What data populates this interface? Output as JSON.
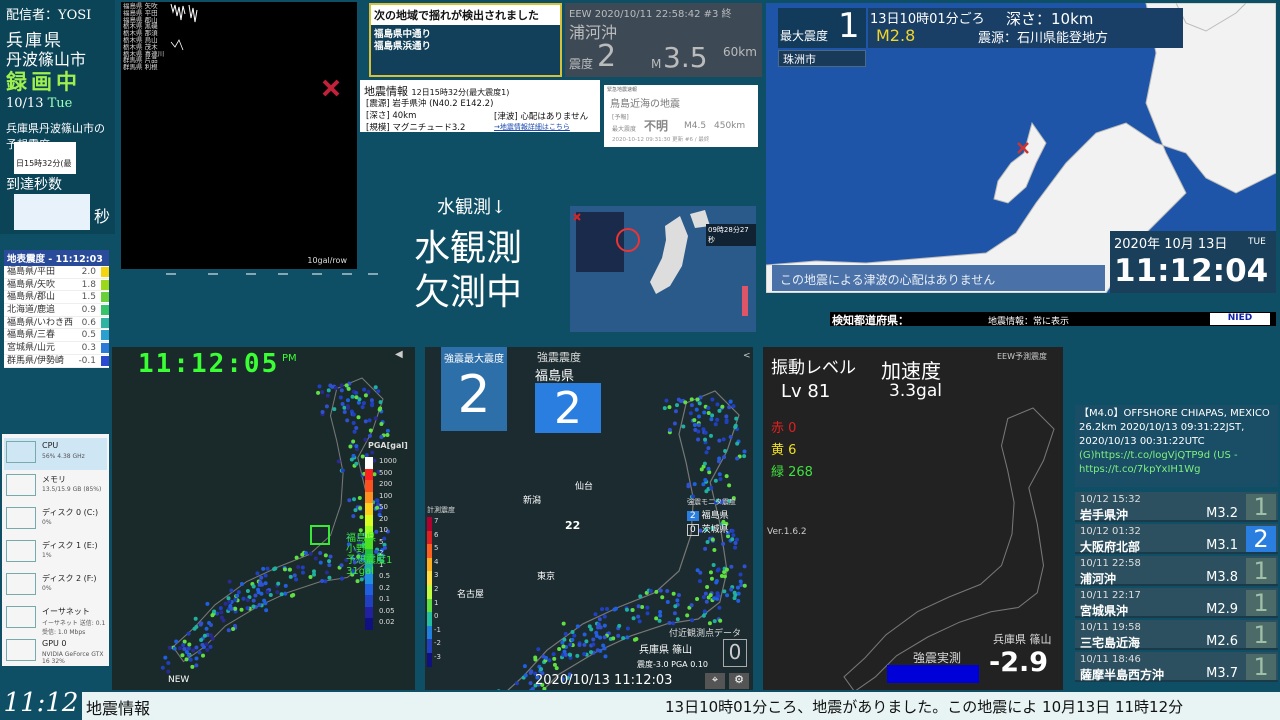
{
  "left": {
    "streamer": "配信者：YOSI",
    "prefecture": "兵庫県",
    "city": "丹波篠山市",
    "recording": "録画中",
    "date": "10/13",
    "weekday": "Tue",
    "forecast_label_1": "兵庫県丹波篠山市の",
    "forecast_label_2": "予想震度",
    "small_1": "日15時32分(最",
    "arrival_label": "到達秒数",
    "seconds_unit": "秒"
  },
  "waveform": {
    "stations": [
      "福島県 矢吹",
      "福島県 平田",
      "福島県 郡山",
      "栃木県 黒磯",
      "栃木県 那須",
      "栃木県 烏山",
      "栃木県 茂木",
      "栃木県 喜連川",
      "群馬県 片品",
      "群馬県 利根"
    ],
    "scale": "10gal/row"
  },
  "seismo_list": {
    "title": "地表震度 - 11:12:03",
    "rows": [
      {
        "name": "福島県/平田",
        "value": "2.0",
        "color": "#f4d40c"
      },
      {
        "name": "福島県/矢吹",
        "value": "1.8",
        "color": "#9bd81a"
      },
      {
        "name": "福島県/郡山",
        "value": "1.5",
        "color": "#6ad03a"
      },
      {
        "name": "北海道/鹿追",
        "value": "0.9",
        "color": "#36c36a"
      },
      {
        "name": "福島県/いわき西",
        "value": "0.6",
        "color": "#2eb4a0"
      },
      {
        "name": "福島県/三春",
        "value": "0.5",
        "color": "#2a9fd0"
      },
      {
        "name": "宮城県/山元",
        "value": "0.3",
        "color": "#2a7ad8"
      },
      {
        "name": "群馬県/伊勢崎",
        "value": "-0.1",
        "color": "#2a4ad0"
      }
    ]
  },
  "perf": [
    {
      "name": "CPU",
      "detail": "56% 4.38 GHz"
    },
    {
      "name": "メモリ",
      "detail": "13.5/15.9 GB (85%)"
    },
    {
      "name": "ディスク 0 (C:)",
      "detail": "0%"
    },
    {
      "name": "ディスク 1 (E:)",
      "detail": "1%"
    },
    {
      "name": "ディスク 2 (F:)",
      "detail": "0%"
    },
    {
      "name": "イーサネット",
      "detail": "イーサネット 送信: 0.1 受信: 1.0 Mbps"
    },
    {
      "name": "GPU 0",
      "detail": "NVIDIA GeForce GTX 16 32%"
    }
  ],
  "detect": {
    "header": "次の地域で揺れが検出されました",
    "areas": [
      "福島県中通り",
      "福島県浜通り"
    ]
  },
  "eew": {
    "meta": "EEW 2020/10/11 22:58:42 #3 終",
    "place": "浦河沖",
    "intensity_label": "震度",
    "intensity": "2",
    "mag_label": "M",
    "mag": "3.5",
    "depth": "60km"
  },
  "info12": {
    "title": "地震情報",
    "sub": "12日15時32分(最大震度1)",
    "epicenter_label": "[震源]",
    "epicenter": "岩手県沖",
    "coords": "(N40.2 E142.2)",
    "depth_label": "[深さ]",
    "depth": "40km",
    "tsunami_label": "[津波]",
    "tsunami": "心配はありません",
    "scale_label": "[規模]",
    "scale": "マグニチュード3.2",
    "link": "→地震情報詳細はこちら"
  },
  "forecast": {
    "head": "緊急地震速報",
    "place": "鳥島近海の地震",
    "tag": "[予報]",
    "max_label": "最大震度",
    "max": "不明",
    "mag": "M4.5",
    "depth": "450km",
    "time": "2020-10-12 09:31:30 更新 #6 / 最終"
  },
  "water": {
    "top": "水観測↓",
    "line1": "水観測",
    "line2": "欠測中"
  },
  "mini": {
    "time": "09時28分27秒"
  },
  "rmap": {
    "max_label": "最大震度",
    "max": "1",
    "time": "13日10時01分ごろ",
    "mag": "M2.8",
    "depth_label": "深さ：",
    "depth": "10km",
    "epi_label": "震源：",
    "epi": "石川県能登地方",
    "area": "珠洲市",
    "tsunami": "この地震による津波の心配はありません",
    "date": "2020年 10月 13日",
    "weekday": "TUE",
    "clock": "11:12:04"
  },
  "ticker": {
    "left": "検知都道府県：",
    "mid": "地震情報：常に表示"
  },
  "map1": {
    "clock": "11:12:05",
    "ampm": "PM",
    "legend_title": "PGA[gal]",
    "legend": [
      "1000",
      "500",
      "200",
      "100",
      "50",
      "20",
      "10",
      "5",
      "2",
      "1",
      "0.5",
      "0.2",
      "0.1",
      "0.05",
      "0.02"
    ],
    "label_pref": "福島県",
    "label_city": "小野",
    "label_forecast": "予想震度1",
    "label_gal": "31gal",
    "new": "NEW"
  },
  "map2": {
    "max_label": "強震最大震度",
    "max": "2",
    "pref_intensity_label": "強震震度",
    "pref": "福島県",
    "pref_value": "2",
    "scale_title": "計測震度",
    "scale": [
      "7",
      "6",
      "5",
      "4",
      "3",
      "2",
      "1",
      "0",
      "-1",
      "-2",
      "-3"
    ],
    "monitor_title": "強震モニタ震度",
    "monitor": [
      {
        "v": "2",
        "n": "福島県"
      },
      {
        "v": "0",
        "n": "茨城県"
      }
    ],
    "nearby": "付近観測点データ",
    "nearby_place": "兵庫県 篠山",
    "nearby_values": "震度-3.0 PGA 0.10",
    "nearby_int": "0",
    "labels": [
      "新潟",
      "仙台",
      "22",
      "名古屋",
      "東京"
    ],
    "timestamp": "2020/10/13 11:12:03"
  },
  "map3": {
    "vib_label": "振動レベル",
    "vib": "Lv 81",
    "acc_label": "加速度",
    "acc": "3.3gal",
    "red": "赤 0",
    "yellow": "黄 6",
    "green": "緑 268",
    "eew_label": "EEW予測震度",
    "ver": "Ver.1.6.2",
    "station": "兵庫県 篠山",
    "strong_label": "強震実測",
    "strong_value": "-2.9"
  },
  "twitter": {
    "text": "【M4.0】OFFSHORE CHIAPAS, MEXICO 26.2km 2020/10/13 09:31:22JST, 2020/10/13 00:31:22UTC",
    "link1": "(G)https://t.co/logVjQTP9d (US - https://t.co/7kpYxIH1Wg"
  },
  "history": [
    {
      "date": "10/12 15:32",
      "place": "岩手県沖",
      "mag": "M3.2",
      "int": "1",
      "hl": false
    },
    {
      "date": "10/12 01:32",
      "place": "大阪府北部",
      "mag": "M3.1",
      "int": "2",
      "hl": true
    },
    {
      "date": "10/11 22:58",
      "place": "浦河沖",
      "mag": "M3.8",
      "int": "1",
      "hl": false
    },
    {
      "date": "10/11 22:17",
      "place": "宮城県沖",
      "mag": "M2.9",
      "int": "1",
      "hl": false
    },
    {
      "date": "10/11 19:58",
      "place": "三宅島近海",
      "mag": "M2.6",
      "int": "1",
      "hl": false
    },
    {
      "date": "10/11 18:46",
      "place": "薩摩半島西方沖",
      "mag": "M3.7",
      "int": "1",
      "hl": false
    }
  ],
  "footer": {
    "clock": "11:12",
    "label": "地震情報",
    "message": "13日10時01分ころ、地震がありました。この地震によ 10月13日 11時12分"
  }
}
